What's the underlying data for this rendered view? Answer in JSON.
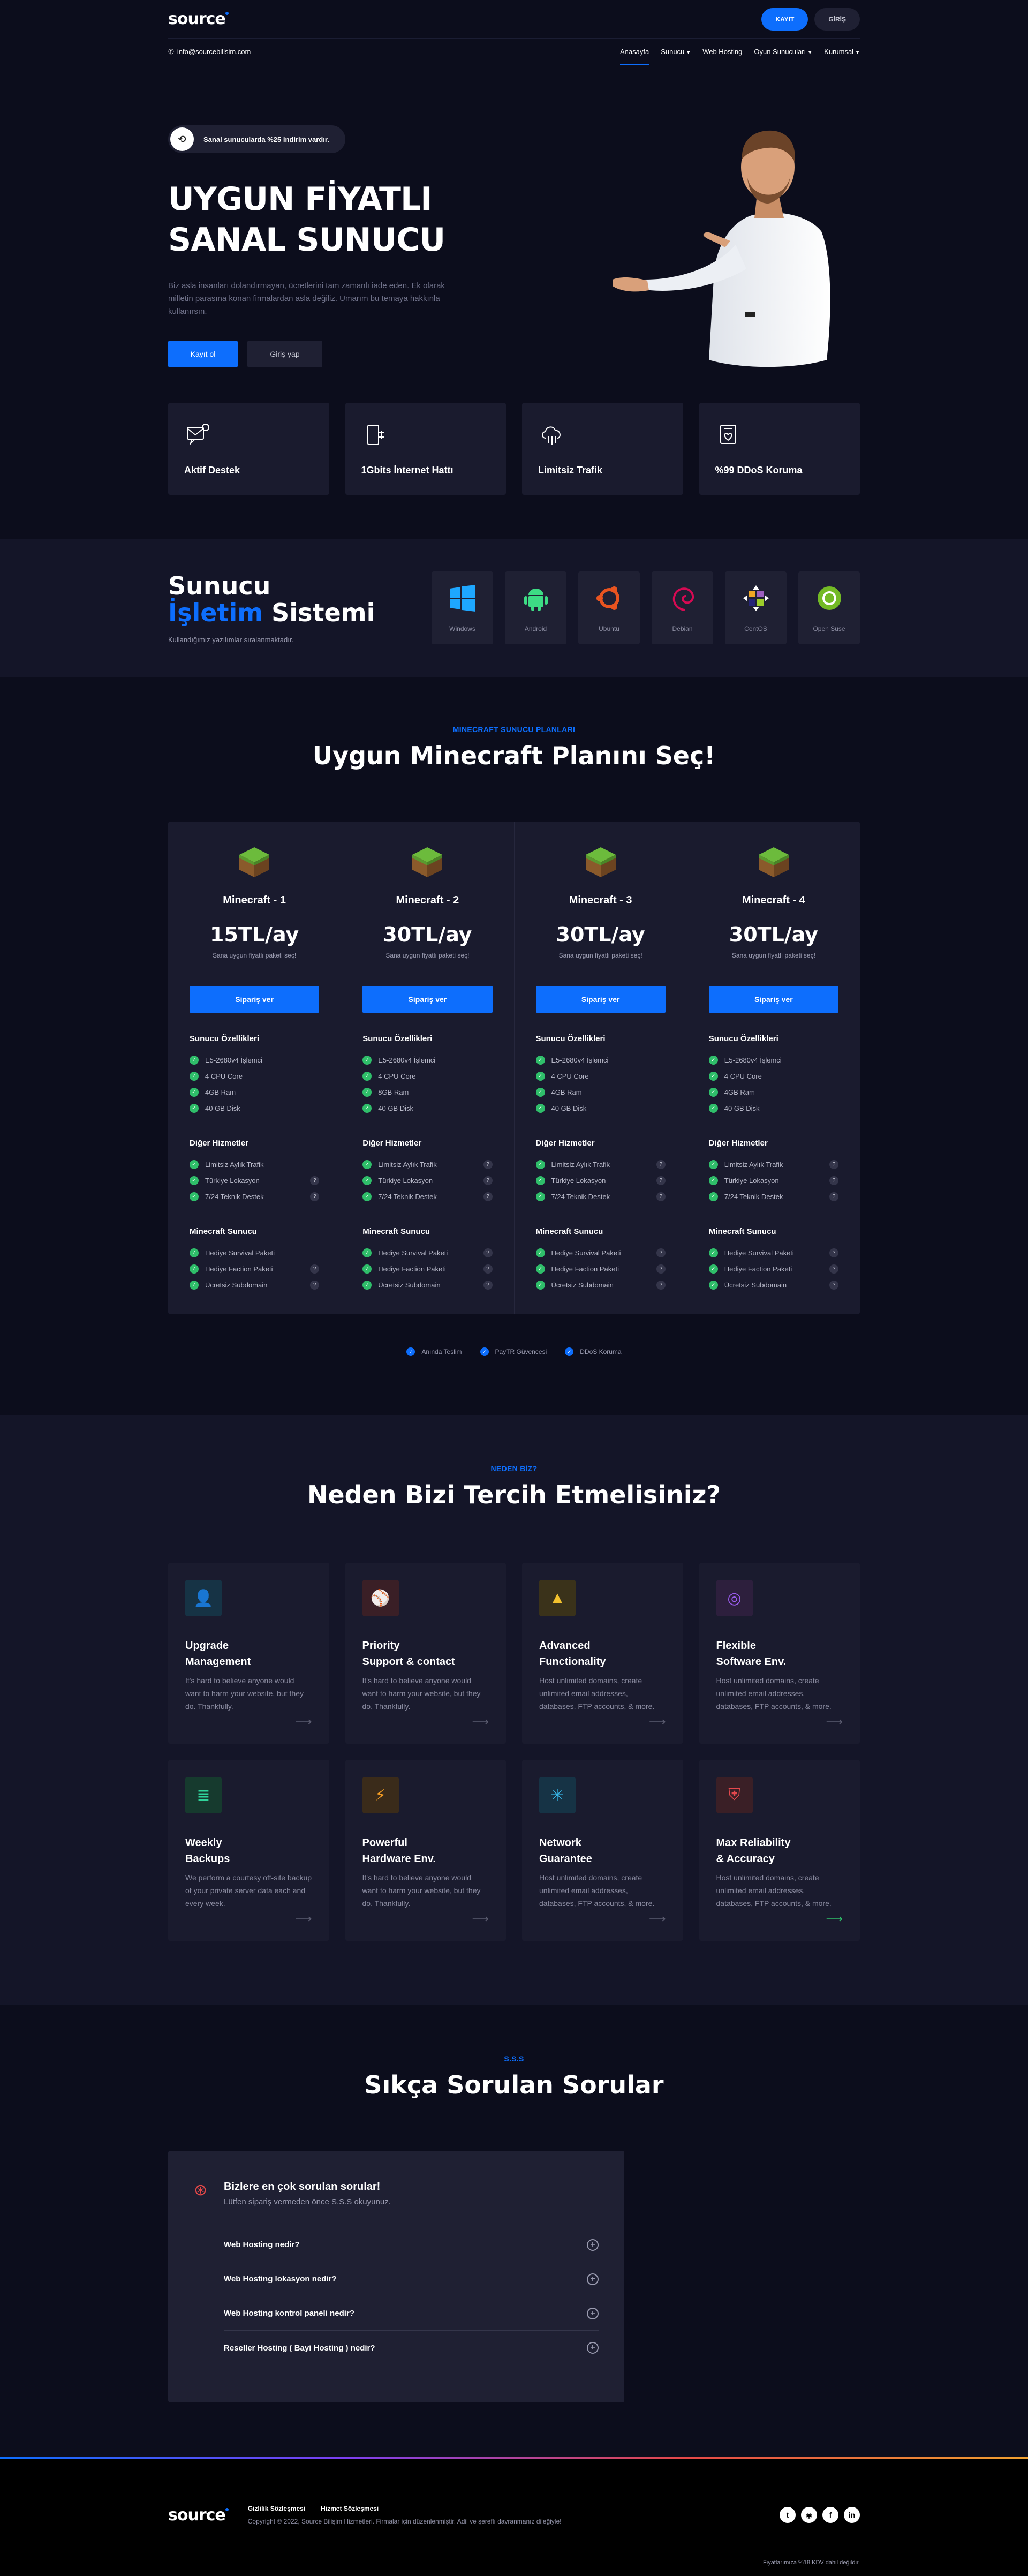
{
  "header": {
    "logo": "source",
    "register_label": "KAYIT",
    "login_label": "GİRİŞ",
    "email": "info@sourcebilisim.com",
    "nav": [
      "Anasayfa",
      "Sunucu",
      "Web Hosting",
      "Oyun Sunucuları",
      "Kurumsal"
    ]
  },
  "hero": {
    "promo": "Sanal sunucularda %25 indirim vardır.",
    "title_line1": "UYGUN FİYATLI",
    "title_line2": "SANAL SUNUCU",
    "description": "Biz asla insanları dolandırmayan, ücretlerini tam zamanlı iade eden. Ek olarak milletin parasına konan firmalardan asla değiliz. Umarım bu temaya hakkınla kullanırsın.",
    "primary_button": "Kayıt ol",
    "secondary_button": "Giriş yap"
  },
  "features": [
    {
      "label": "Aktif Destek",
      "icon": "chat-support-icon"
    },
    {
      "label": "1Gbits İnternet Hattı",
      "icon": "network-plug-icon"
    },
    {
      "label": "Limitsiz Trafik",
      "icon": "cloud-icon"
    },
    {
      "label": "%99 DDoS Koruma",
      "icon": "shield-heart-icon"
    }
  ],
  "os": {
    "title_line1": "Sunucu",
    "title_blue": "İşletim",
    "title_rest": " Sistemi",
    "subtitle": "Kullandığımız yazılımlar sıralanmaktadır.",
    "items": [
      {
        "label": "Windows",
        "color": "#1ea7ff"
      },
      {
        "label": "Android",
        "color": "#3ddc84"
      },
      {
        "label": "Ubuntu",
        "color": "#e95420"
      },
      {
        "label": "Debian",
        "color": "#d70a53"
      },
      {
        "label": "CentOS",
        "color": "#9c5fbf"
      },
      {
        "label": "Open Suse",
        "color": "#73ba25"
      }
    ]
  },
  "plans": {
    "eyebrow": "MINECRAFT SUNUCU PLANLARI",
    "title": "Uygun Minecraft Planını Seç!",
    "section_specs": "Sunucu Özellikleri",
    "section_other": "Diğer Hizmetler",
    "section_mc": "Minecraft Sunucu",
    "order_label": "Sipariş ver",
    "items": [
      {
        "name": "Minecraft - 1",
        "price": "15TL/ay",
        "sub": "Sana uygun fiyatlı paketi seç!",
        "specs": [
          "E5-2680v4 İşlemci",
          "4 CPU Core",
          "4GB Ram",
          "40 GB Disk"
        ],
        "other": [
          "Limitsiz Aylık Trafik",
          "Türkiye Lokasyon",
          "7/24 Teknik Destek"
        ],
        "mc": [
          "Hediye Survival Paketi",
          "Hediye Faction Paketi",
          "Ücretsiz Subdomain"
        ]
      },
      {
        "name": "Minecraft - 2",
        "price": "30TL/ay",
        "sub": "Sana uygun fiyatlı paketi seç!",
        "specs": [
          "E5-2680v4 İşlemci",
          "4 CPU Core",
          "8GB Ram",
          "40 GB Disk"
        ],
        "other": [
          "Limitsiz Aylık Trafik",
          "Türkiye Lokasyon",
          "7/24 Teknik Destek"
        ],
        "mc": [
          "Hediye Survival Paketi",
          "Hediye Faction Paketi",
          "Ücretsiz Subdomain"
        ]
      },
      {
        "name": "Minecraft - 3",
        "price": "30TL/ay",
        "sub": "Sana uygun fiyatlı paketi seç!",
        "specs": [
          "E5-2680v4 İşlemci",
          "4 CPU Core",
          "4GB Ram",
          "40 GB Disk"
        ],
        "other": [
          "Limitsiz Aylık Trafik",
          "Türkiye Lokasyon",
          "7/24 Teknik Destek"
        ],
        "mc": [
          "Hediye Survival Paketi",
          "Hediye Faction Paketi",
          "Ücretsiz Subdomain"
        ]
      },
      {
        "name": "Minecraft - 4",
        "price": "30TL/ay",
        "sub": "Sana uygun fiyatlı paketi seç!",
        "specs": [
          "E5-2680v4 İşlemci",
          "4 CPU Core",
          "4GB Ram",
          "40 GB Disk"
        ],
        "other": [
          "Limitsiz Aylık Trafik",
          "Türkiye Lokasyon",
          "7/24 Teknik Destek"
        ],
        "mc": [
          "Hediye Survival Paketi",
          "Hediye Faction Paketi",
          "Ücretsiz Subdomain"
        ]
      }
    ],
    "checks": [
      "Anında Teslim",
      "PayTR Güvencesi",
      "DDoS Koruma"
    ]
  },
  "why": {
    "eyebrow": "NEDEN BİZ?",
    "title": "Neden Bizi Tercih Etmelisiniz?",
    "cards": [
      {
        "t1": "Upgrade",
        "t2": "Management",
        "desc": "It's hard to believe anyone would want to harm your website, but they do. Thankfully.",
        "icon": "user-upgrade-icon",
        "bg": "#163345",
        "fg": "#36b6e8",
        "glyph": "👤"
      },
      {
        "t1": "Priority",
        "t2": "Support & contact",
        "desc": "It's hard to believe anyone would want to harm your website, but they do. Thankfully.",
        "icon": "tennis-ball-icon",
        "bg": "#3a1f26",
        "fg": "#e5484d",
        "glyph": "⚾"
      },
      {
        "t1": "Advanced",
        "t2": "Functionality",
        "desc": "Host unlimited domains, create unlimited email addresses, databases, FTP accounts, & more.",
        "icon": "compass-icon",
        "bg": "#3a321a",
        "fg": "#f2c12e",
        "glyph": "▲"
      },
      {
        "t1": "Flexible",
        "t2": "Software Env.",
        "desc": "Host unlimited domains, create unlimited email addresses, databases, FTP accounts, & more.",
        "icon": "lifebuoy-icon",
        "bg": "#2d1f3d",
        "fg": "#9b5cf0",
        "glyph": "◎"
      },
      {
        "t1": "Weekly",
        "t2": "Backups",
        "desc": "We perform a courtesy off-site backup of your private server data each and every week.",
        "icon": "database-icon",
        "bg": "#163a2e",
        "fg": "#2fd39a",
        "glyph": "≣"
      },
      {
        "t1": "Powerful",
        "t2": "Hardware Env.",
        "desc": "It's hard to believe anyone would want to harm your website, but they do. Thankfully.",
        "icon": "lightning-icon",
        "bg": "#3a2b1a",
        "fg": "#f39c23",
        "glyph": "⚡"
      },
      {
        "t1": "Network",
        "t2": "Guarantee",
        "desc": "Host unlimited domains, create unlimited email addresses, databases, FTP accounts, & more.",
        "icon": "network-nodes-icon",
        "bg": "#163345",
        "fg": "#36b6e8",
        "glyph": "✳"
      },
      {
        "t1": "Max Reliability",
        "t2": "& Accuracy",
        "desc": "Host unlimited domains, create unlimited email addresses, databases, FTP accounts, & more.",
        "icon": "shield-icon",
        "bg": "#3a1f26",
        "fg": "#e5484d",
        "glyph": "⛨"
      }
    ]
  },
  "faq": {
    "eyebrow": "S.S.S",
    "title": "Sıkça Sorulan Sorular",
    "box_title": "Bizlere en çok sorulan sorular!",
    "box_sub": "Lütfen sipariş vermeden önce S.S.S okuyunuz.",
    "items": [
      "Web Hosting nedir?",
      "Web Hosting lokasyon nedir?",
      "Web Hosting kontrol paneli nedir?",
      "Reseller Hosting ( Bayi Hosting ) nedir?"
    ]
  },
  "footer": {
    "logo": "source",
    "link1": "Gizlilik Sözleşmesi",
    "link2": "Hizmet Sözleşmesi",
    "copyright": "Copyright © 2022, Source Bilişim Hizmetleri. Firmalar için düzenlenmiştir. Adil ve şereflı davranmanız dileğiyle!",
    "social": [
      "t",
      "◉",
      "f",
      "in"
    ],
    "vat": "Fiyatlarımıza %18 KDV dahil değildir."
  }
}
